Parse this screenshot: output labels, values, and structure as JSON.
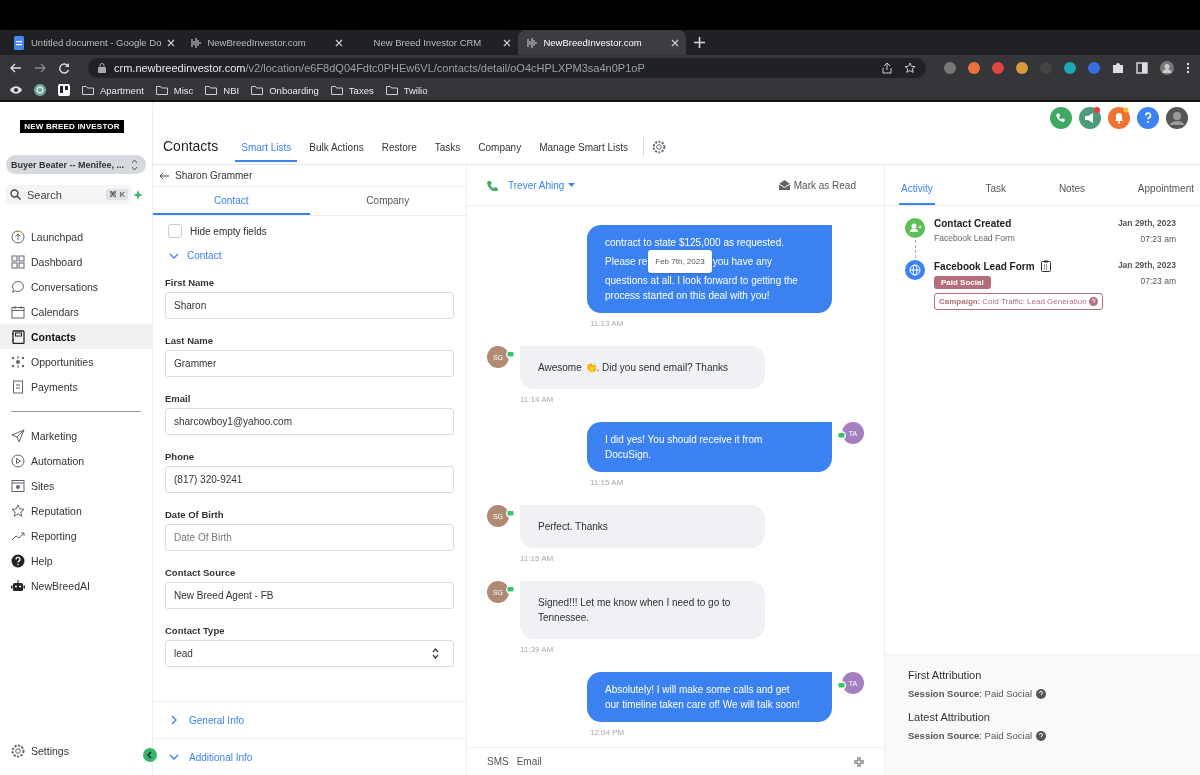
{
  "browser": {
    "tabs": [
      {
        "title": "Untitled document - Google Do",
        "selected": false
      },
      {
        "title": "NewBreedInvestor.com",
        "selected": false
      },
      {
        "title": "New Breed Investor CRM",
        "selected": false
      },
      {
        "title": "NewBreedInvestor.com",
        "selected": true
      }
    ],
    "url_host": "crm.newbreedinvestor.com",
    "url_path": "/v2/location/e6F8dQ04Fdtc0PHEw6VL/contacts/detail/oO4cHPLXPM3sa4n0P1oP",
    "bookmarks": [
      "Apartment",
      "Misc",
      "NBI",
      "Onboarding",
      "Taxes",
      "Twilio"
    ]
  },
  "sidebar": {
    "logo": "NEW BREED INVESTOR",
    "location": "Buyer Beater -- Menifee, ...",
    "search": {
      "placeholder": "Search",
      "shortcut": "⌘ K"
    },
    "groups": [
      [
        {
          "label": "Launchpad",
          "selected": false
        },
        {
          "label": "Dashboard",
          "selected": false
        },
        {
          "label": "Conversations",
          "selected": false
        },
        {
          "label": "Calendars",
          "selected": false
        },
        {
          "label": "Contacts",
          "selected": true
        },
        {
          "label": "Opportunities",
          "selected": false
        },
        {
          "label": "Payments",
          "selected": false
        }
      ],
      [
        {
          "label": "Marketing",
          "selected": false
        },
        {
          "label": "Automation",
          "selected": false
        },
        {
          "label": "Sites",
          "selected": false
        },
        {
          "label": "Reputation",
          "selected": false
        },
        {
          "label": "Reporting",
          "selected": false
        },
        {
          "label": "Help",
          "selected": false
        },
        {
          "label": "NewBreedAI",
          "selected": false
        }
      ]
    ],
    "settings": "Settings"
  },
  "header": {
    "title": "Contacts",
    "tabs": [
      {
        "label": "Smart Lists",
        "selected": true
      },
      {
        "label": "Bulk Actions",
        "selected": false
      },
      {
        "label": "Restore",
        "selected": false
      },
      {
        "label": "Tasks",
        "selected": false
      },
      {
        "label": "Company",
        "selected": false
      },
      {
        "label": "Manage Smart Lists",
        "selected": false
      }
    ]
  },
  "contact": {
    "name": "Sharon Grammer",
    "tabs": [
      {
        "label": "Contact",
        "selected": true
      },
      {
        "label": "Company",
        "selected": false
      }
    ],
    "hide_empty": {
      "label": "Hide empty fields",
      "checked": false
    },
    "section": {
      "title": "Contact",
      "expanded": true
    },
    "fields": [
      {
        "label": "First Name",
        "value": "Sharon",
        "kind": "text"
      },
      {
        "label": "Last Name",
        "value": "Grammer",
        "kind": "text"
      },
      {
        "label": "Email",
        "value": "sharcowboy1@yahoo.com",
        "kind": "text"
      },
      {
        "label": "Phone",
        "value": "(817) 320-9241",
        "kind": "text"
      },
      {
        "label": "Date Of Birth",
        "placeholder": "Date Of Birth",
        "kind": "text"
      },
      {
        "label": "Contact Source",
        "value": "New Breed Agent - FB",
        "kind": "text"
      },
      {
        "label": "Contact Type",
        "value": "lead",
        "kind": "select"
      }
    ],
    "sections": [
      {
        "title": "General Info",
        "expanded": false
      },
      {
        "title": "Additional Info",
        "expanded": true
      }
    ]
  },
  "conversation": {
    "contact": "Trever Ahing",
    "mark_read": "Mark as Read",
    "messages": [
      {
        "kind": "outgoing",
        "date_chip": "Feb 7th, 2023",
        "lines": [
          [
            "contract to state $125,000 as requested."
          ],
          [
            "Please re",
            "you have any"
          ],
          [
            "questions at all. I look forward to getting the"
          ],
          [
            "process started on this deal with you!"
          ]
        ],
        "time": "11:13 AM"
      },
      {
        "kind": "incoming",
        "initials": "SG",
        "color": "#b08a72",
        "lines": [
          [
            "Awesome 👏. Did you send email?   Thanks"
          ]
        ],
        "time": "11:14 AM"
      },
      {
        "kind": "outgoing",
        "initials": "TA",
        "color": "#a57fc0",
        "lines": [
          [
            "I did yes! You should receive it from"
          ],
          [
            "DocuSign."
          ]
        ],
        "time": "11:15 AM"
      },
      {
        "kind": "incoming",
        "initials": "SG",
        "color": "#b08a72",
        "lines": [
          [
            "Perfect.   Thanks"
          ]
        ],
        "time": "11:15 AM"
      },
      {
        "kind": "incoming",
        "initials": "SG",
        "color": "#b08a72",
        "lines": [
          [
            "Signed!!! Let me know when I need to go to"
          ],
          [
            "Tennessee."
          ]
        ],
        "time": "11:39 AM"
      },
      {
        "kind": "outgoing",
        "initials": "TA",
        "color": "#a57fc0",
        "lines": [
          [
            "Absolutely! I will make some calls and get"
          ],
          [
            "our timeline taken care of! We will talk soon!"
          ]
        ],
        "time": "12:04 PM"
      }
    ],
    "channels": [
      "SMS",
      "Email"
    ]
  },
  "activity": {
    "tabs": [
      {
        "label": "Activity",
        "selected": true
      },
      {
        "label": "Task",
        "selected": false
      },
      {
        "label": "Notes",
        "selected": false
      },
      {
        "label": "Appointment",
        "selected": false
      }
    ],
    "events": [
      {
        "kind": "contact",
        "title": "Contact Created",
        "subtitle": "Facebook Lead Form",
        "date": "Jan 29th, 2023",
        "time": "07:23 am"
      },
      {
        "kind": "form",
        "title": "Facebook Lead Form",
        "tag": "Paid Social",
        "campaign_label": "Campaign:",
        "campaign_value": "Cold Traffic: Lead Generation",
        "date": "Jan 29th, 2023",
        "time": "07:23 am"
      }
    ],
    "attributions": [
      {
        "title": "First Attribution",
        "label": "Session Source",
        "value": ": Paid Social"
      },
      {
        "title": "Latest Attribution",
        "label": "Session Source",
        "value": ": Paid Social"
      }
    ]
  }
}
